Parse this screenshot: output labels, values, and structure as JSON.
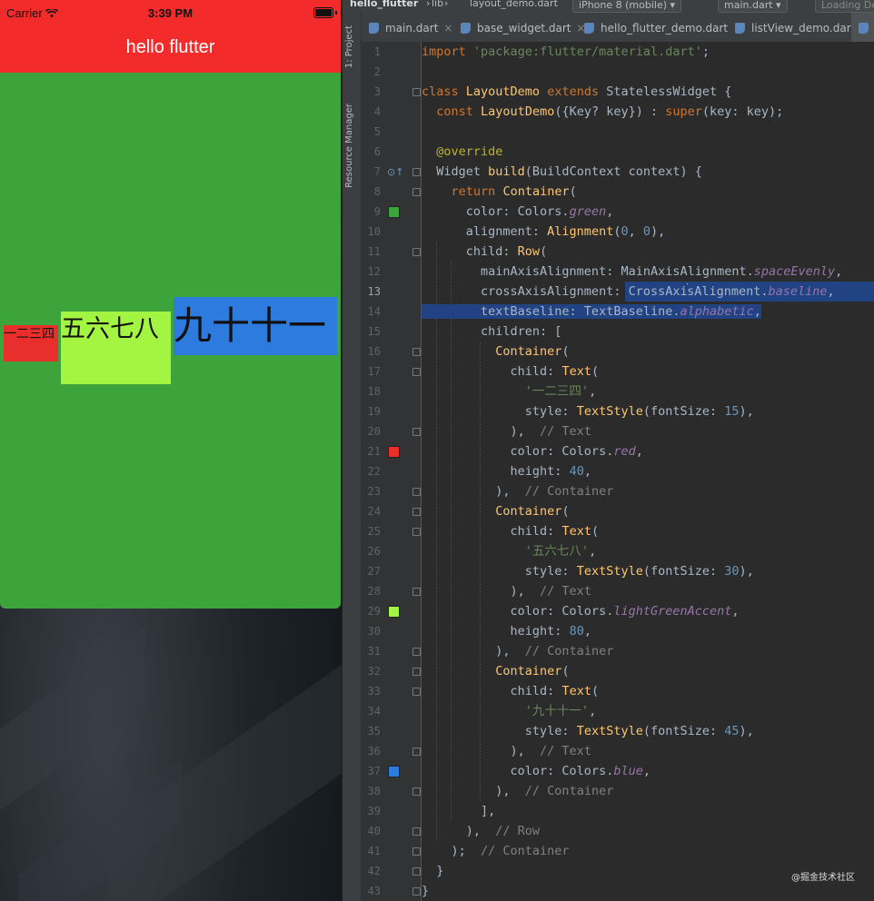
{
  "simulator": {
    "status_bar": {
      "carrier": "Carrier",
      "time": "3:39 PM"
    },
    "app_bar_title": "hello flutter",
    "colors": {
      "app_bar": "#f42b2b",
      "background": "#3ca43a",
      "box1": "#e92f2b",
      "box2": "#a4f542",
      "box3": "#2d7bdf"
    },
    "row_items": [
      {
        "text": "一二三四",
        "height": 40
      },
      {
        "text": "五六七八",
        "height": 80
      },
      {
        "text": "九十十一"
      }
    ]
  },
  "ide": {
    "nav": {
      "project": "hello_flutter",
      "lib": "lib",
      "file": "layout_demo.dart",
      "device": "iPhone 8 (mobile)",
      "run_config": "main.dart",
      "loading": "Loading De"
    },
    "side_tools": {
      "project": "1: Project",
      "resource_manager": "Resource Manager"
    },
    "tabs": [
      {
        "label": "main.dart"
      },
      {
        "label": "base_widget.dart"
      },
      {
        "label": "hello_flutter_demo.dart"
      },
      {
        "label": "listView_demo.dart"
      }
    ],
    "current_line": 13,
    "code_lines": [
      "import 'package:flutter/material.dart';",
      "",
      "class LayoutDemo extends StatelessWidget {",
      "  const LayoutDemo({Key? key}) : super(key: key);",
      "",
      "  @override",
      "  Widget build(BuildContext context) {",
      "    return Container(",
      "      color: Colors.green,",
      "      alignment: Alignment(0, 0),",
      "      child: Row(",
      "        mainAxisAlignment: MainAxisAlignment.spaceEvenly,",
      "        crossAxisAlignment: CrossAxisAlignment.baseline,",
      "        textBaseline: TextBaseline.alphabetic,",
      "        children: [",
      "          Container(",
      "            child: Text(",
      "              '一二三四',",
      "              style: TextStyle(fontSize: 15),",
      "            ),  // Text",
      "            color: Colors.red,",
      "            height: 40,",
      "          ),  // Container",
      "          Container(",
      "            child: Text(",
      "              '五六七八',",
      "              style: TextStyle(fontSize: 30),",
      "            ),  // Text",
      "            color: Colors.lightGreenAccent,",
      "            height: 80,",
      "          ),  // Container",
      "          Container(",
      "            child: Text(",
      "              '九十十一',",
      "              style: TextStyle(fontSize: 45),",
      "            ),  // Text",
      "            color: Colors.blue,",
      "          ),  // Container",
      "        ],",
      "      ),  // Row",
      "    );  // Container",
      "  }",
      "}"
    ],
    "gutter_swatches": [
      {
        "line": 9,
        "color": "#3ca43a"
      },
      {
        "line": 21,
        "color": "#e92f2b"
      },
      {
        "line": 29,
        "color": "#a4f542"
      },
      {
        "line": 37,
        "color": "#2d7bdf"
      }
    ],
    "watermark": "@掘金技术社区"
  }
}
